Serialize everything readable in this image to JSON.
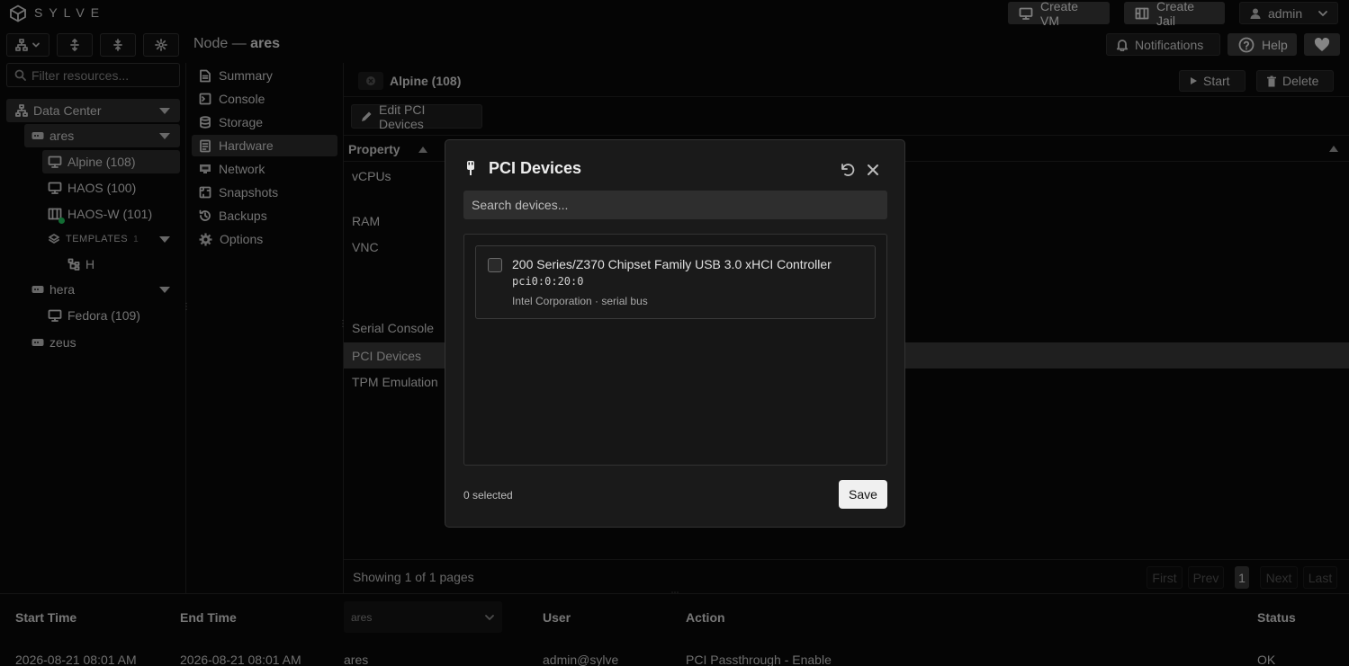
{
  "app": {
    "logo_text": "SYLVE"
  },
  "topbar": {
    "create_vm": "Create VM",
    "create_jail": "Create Jail",
    "user": "admin",
    "notifications": "Notifications",
    "help": "Help"
  },
  "node_title": {
    "prefix": "Node —",
    "name": "ares"
  },
  "filter": {
    "placeholder": "Filter resources..."
  },
  "tree": {
    "datacenter": "Data Center",
    "ares": "ares",
    "alpine": "Alpine (108)",
    "haos": "HAOS (100)",
    "haosw": "HAOS-W (101)",
    "templates": "TEMPLATES",
    "templates_count": "1",
    "template_h": "H",
    "hera": "hera",
    "fedora": "Fedora (109)",
    "zeus": "zeus"
  },
  "menu": [
    "Summary",
    "Console",
    "Storage",
    "Hardware",
    "Network",
    "Snapshots",
    "Backups",
    "Options"
  ],
  "vm": {
    "title": "Alpine (108)",
    "start": "Start",
    "delete": "Delete",
    "edit_pci": "Edit PCI Devices"
  },
  "table": {
    "property_header": "Property",
    "rows": [
      "vCPUs",
      "RAM",
      "VNC",
      "Serial Console",
      "PCI Devices",
      "TPM Emulation"
    ],
    "pager_text": "Showing 1 of 1 pages",
    "first": "First",
    "prev": "Prev",
    "page": "1",
    "next": "Next",
    "last": "Last"
  },
  "log": {
    "headers": {
      "start": "Start Time",
      "end": "End Time",
      "node_select": "ares",
      "user": "User",
      "action": "Action",
      "status": "Status"
    },
    "row": {
      "start": "2026-08-21 08:01 AM",
      "end": "2026-08-21 08:01 AM",
      "node": "ares",
      "user": "admin@sylve",
      "action": "PCI Passthrough - Enable",
      "status": "OK"
    }
  },
  "modal": {
    "title": "PCI Devices",
    "search_placeholder": "Search devices...",
    "device": {
      "name": "200 Series/Z370 Chipset Family USB 3.0 xHCI Controller",
      "address": "pci0:0:20:0",
      "vendor": "Intel Corporation · serial bus",
      "checked": false
    },
    "selected_text": "0 selected",
    "save": "Save"
  },
  "colors": {
    "background": "#0a0a0a",
    "modal_bg": "#1a1a1a",
    "selected_row": "#2d2d2d",
    "status_green": "#22c55e"
  }
}
